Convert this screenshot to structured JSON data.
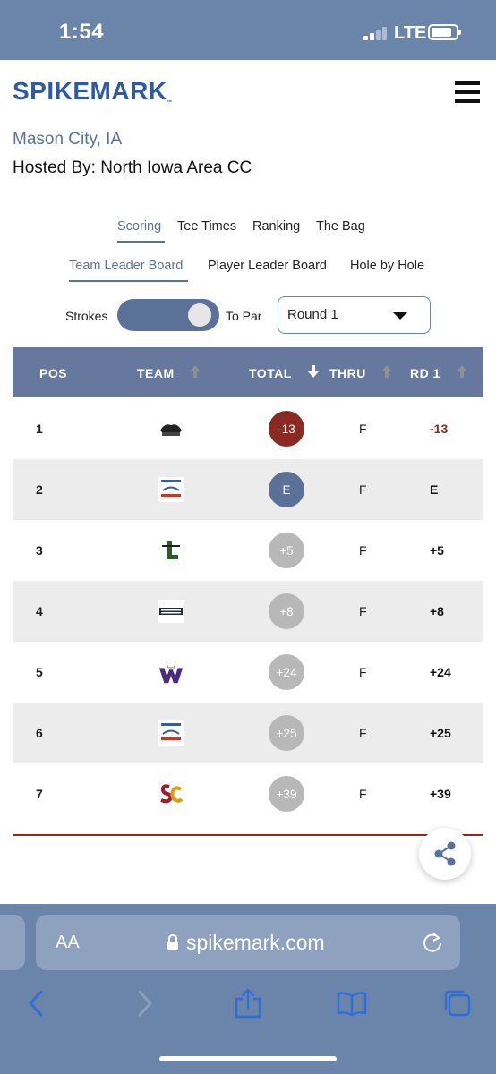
{
  "status_bar": {
    "time": "1:54",
    "network": "LTE"
  },
  "header": {
    "logo_text": "SPIKEMARK",
    "logo_tm": "™"
  },
  "event": {
    "location": "Mason City, IA",
    "host": "Hosted By: North Iowa Area CC"
  },
  "primary_tabs": [
    {
      "label": "Scoring",
      "active": true
    },
    {
      "label": "Tee Times",
      "active": false
    },
    {
      "label": "Ranking",
      "active": false
    },
    {
      "label": "The Bag",
      "active": false
    }
  ],
  "secondary_tabs": [
    {
      "label": "Team Leader Board",
      "active": true
    },
    {
      "label": "Player Leader Board",
      "active": false
    },
    {
      "label": "Hole by Hole",
      "active": false
    }
  ],
  "controls": {
    "strokes_label": "Strokes",
    "to_par_label": "To Par",
    "toggle_state": "To Par",
    "round_select": "Round 1"
  },
  "table": {
    "columns": [
      "POS",
      "TEAM",
      "TOTAL",
      "THRU",
      "RD 1"
    ],
    "rows": [
      {
        "pos": "1",
        "team_logo": "bears-logo",
        "total": "-13",
        "total_color": "#8b2a22",
        "thru": "F",
        "rd1": "-13",
        "rd1_color": "#8b2a22"
      },
      {
        "pos": "2",
        "team_logo": "hawkeye-redtails-logo",
        "total": "E",
        "total_color": "#5c7198",
        "thru": "F",
        "rd1": "E",
        "rd1_color": "#111111"
      },
      {
        "pos": "3",
        "team_logo": "lakers-l-logo",
        "total": "+5",
        "total_color": "#b8b8b8",
        "thru": "F",
        "rd1": "+5",
        "rd1_color": "#111111"
      },
      {
        "pos": "4",
        "team_logo": "trojans-logo",
        "total": "+8",
        "total_color": "#b8b8b8",
        "thru": "F",
        "rd1": "+8",
        "rd1_color": "#111111"
      },
      {
        "pos": "5",
        "team_logo": "warriors-w-logo",
        "total": "+24",
        "total_color": "#b8b8b8",
        "thru": "F",
        "rd1": "+24",
        "rd1_color": "#111111"
      },
      {
        "pos": "6",
        "team_logo": "hawkeye-redtails-logo",
        "total": "+25",
        "total_color": "#b8b8b8",
        "thru": "F",
        "rd1": "+25",
        "rd1_color": "#111111"
      },
      {
        "pos": "7",
        "team_logo": "sc-logo",
        "total": "+39",
        "total_color": "#b8b8b8",
        "thru": "F",
        "rd1": "+39",
        "rd1_color": "#111111"
      }
    ]
  },
  "browser": {
    "text_size_label": "AA",
    "url": "spikemark.com"
  },
  "colors": {
    "brand_blue": "#2f5aa2",
    "header_blue": "#66789d",
    "under_par": "#8b2a22",
    "even_par": "#5c7198",
    "over_par": "#b8b8b8"
  }
}
